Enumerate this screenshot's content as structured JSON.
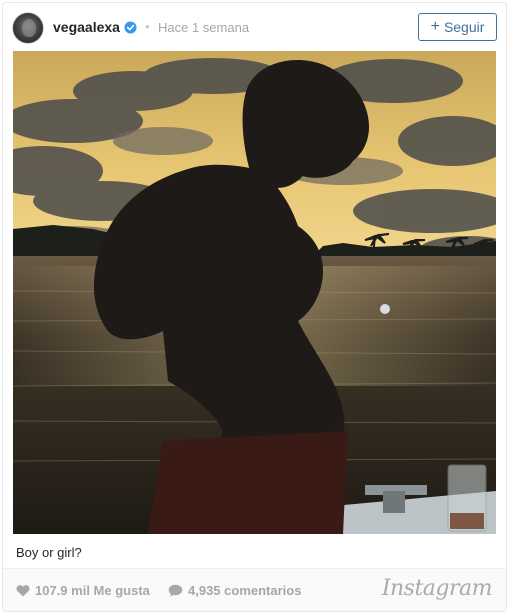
{
  "header": {
    "username": "vegaalexa",
    "separator": "•",
    "timestamp": "Hace 1 semana",
    "follow_label": "Seguir",
    "follow_icon": "+"
  },
  "photo": {
    "description_icon": "photo"
  },
  "caption": {
    "text": "Boy or girl?"
  },
  "footer": {
    "likes": "107.9 mil Me gusta",
    "comments": "4,935 comentarios",
    "logo": "Instagram"
  },
  "colors": {
    "accent": "#3f729b",
    "verified": "#3897f0",
    "muted": "#a5a7aa"
  }
}
